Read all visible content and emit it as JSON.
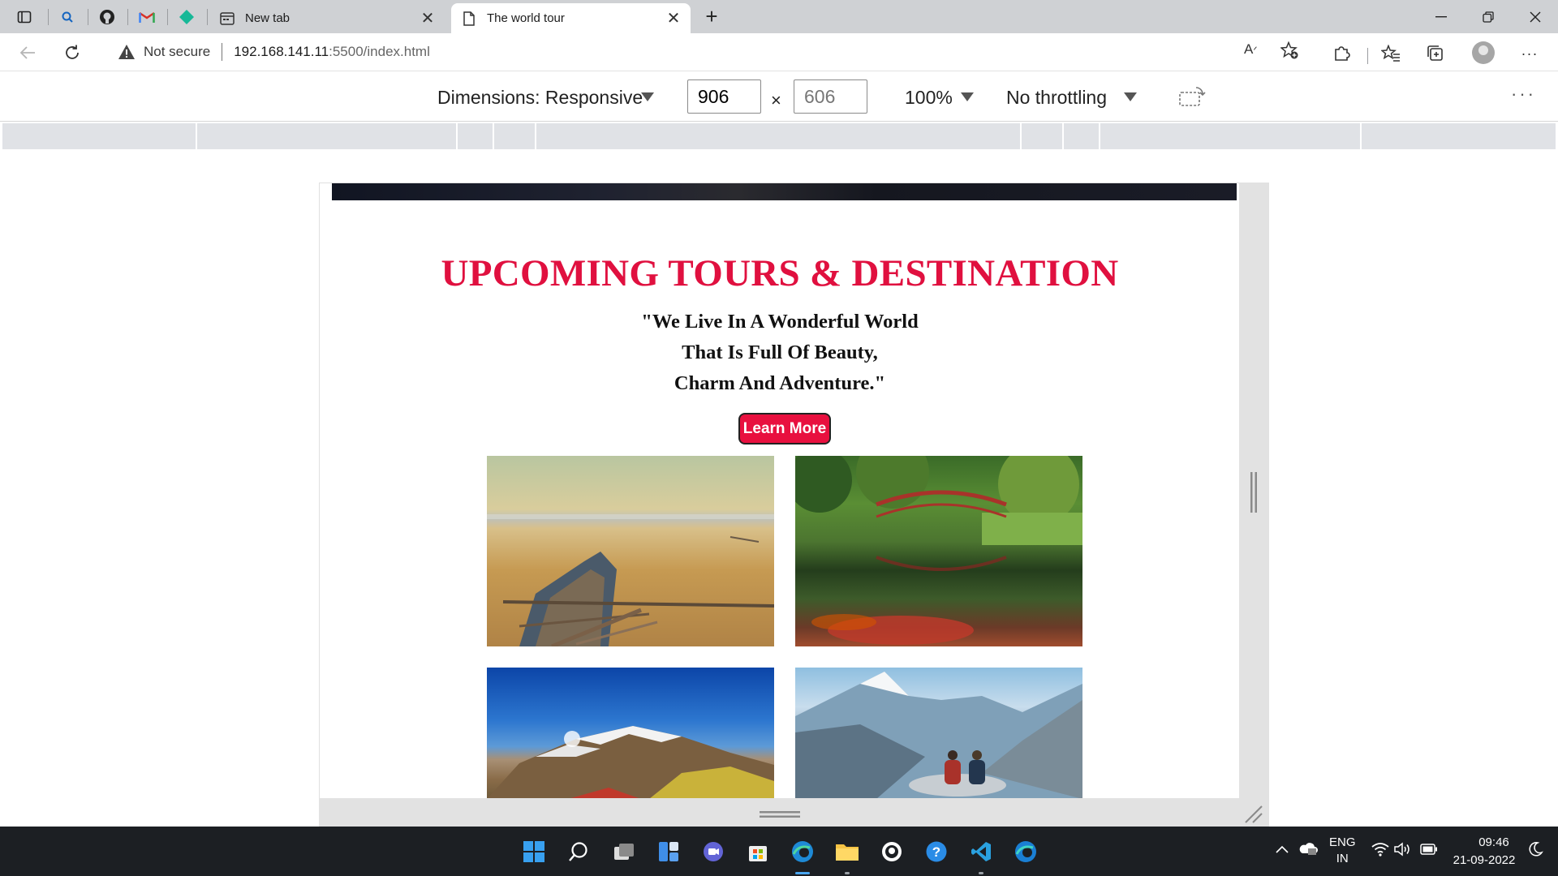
{
  "tabs": [
    {
      "title": "New tab",
      "icon": "new-tab-page-icon",
      "active": false
    },
    {
      "title": "The world tour",
      "icon": "document-icon",
      "active": true
    }
  ],
  "address_bar": {
    "security_label": "Not secure",
    "url_host": "192.168.141.11",
    "url_path": ":5500/index.html"
  },
  "device_toolbar": {
    "dimensions_label": "Dimensions: Responsive",
    "width_value": "906",
    "height_value": "606",
    "times_sign": "×",
    "zoom_label": "100%",
    "throttling_label": "No throttling"
  },
  "page": {
    "heading": "UPCOMING TOURS & DESTINATION",
    "quote_line1": "\"We Live In A Wonderful World",
    "quote_line2": "That Is Full Of Beauty,",
    "quote_line3": "Charm And Adventure.\"",
    "learn_more_label": "Learn More",
    "accent_color": "#e0103f"
  },
  "taskbar": {
    "lang_top": "ENG",
    "lang_bottom": "IN",
    "time": "09:46",
    "date": "21-09-2022"
  }
}
